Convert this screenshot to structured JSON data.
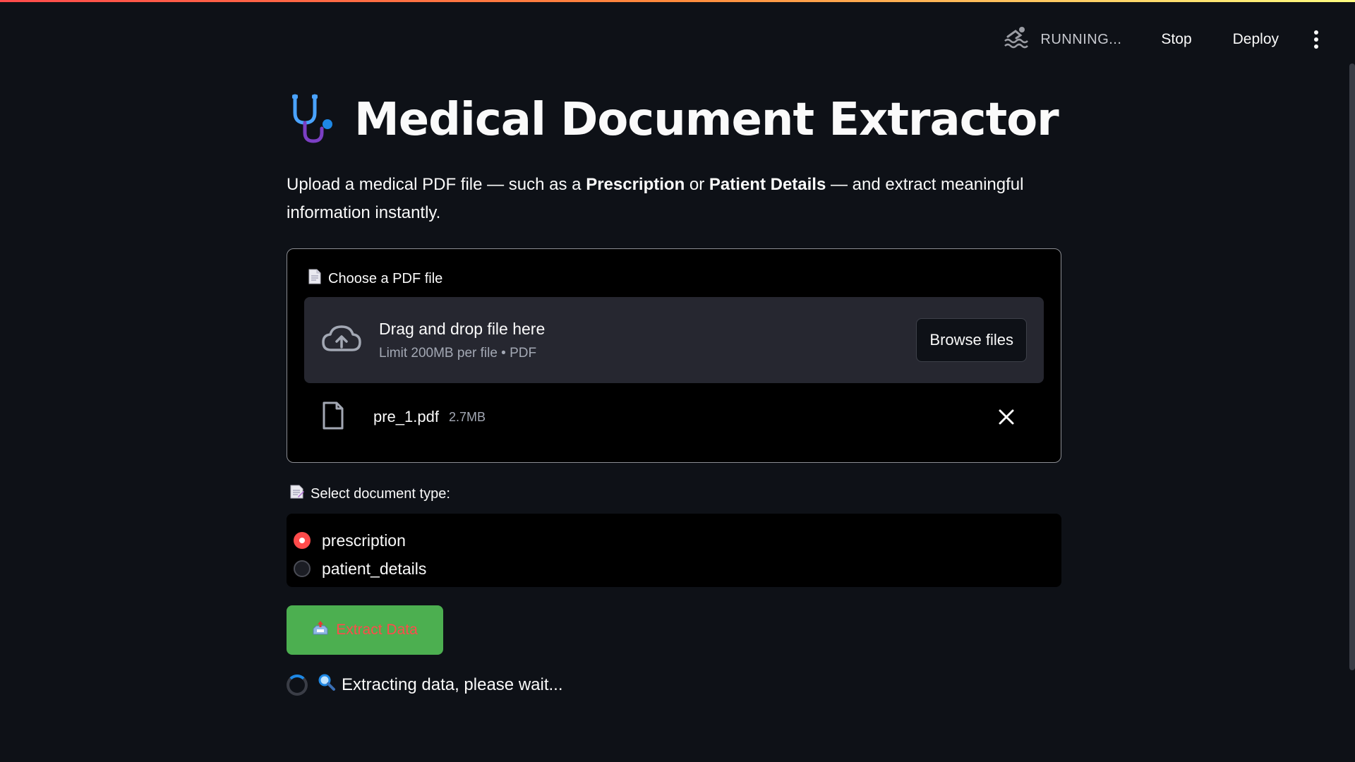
{
  "header": {
    "status_text": "RUNNING...",
    "stop_label": "Stop",
    "deploy_label": "Deploy",
    "status_icon": "swimmer-icon",
    "menu_icon": "kebab-menu-icon"
  },
  "page": {
    "title_icon": "stethoscope-icon",
    "title": "Medical Document Extractor",
    "intro_prefix": "Upload a medical PDF file — such as a ",
    "intro_bold1": "Prescription",
    "intro_mid": " or ",
    "intro_bold2": "Patient Details",
    "intro_suffix": " — and extract meaningful information instantly."
  },
  "uploader": {
    "label": "Choose a PDF file",
    "dropzone_main": "Drag and drop file here",
    "dropzone_sub": "Limit 200MB per file • PDF",
    "browse_label": "Browse files",
    "file": {
      "name": "pre_1.pdf",
      "size": "2.7MB"
    }
  },
  "doc_type": {
    "label": "Select document type:",
    "options": [
      {
        "label": "prescription",
        "selected": true
      },
      {
        "label": "patient_details",
        "selected": false
      }
    ]
  },
  "extract": {
    "label": "Extract Data"
  },
  "spinner": {
    "text": "Extracting data, please wait..."
  },
  "colors": {
    "background": "#0e1117",
    "accent": "#ff4b4b",
    "button_green": "#4caf50",
    "spinner_blue": "#1e88e5"
  }
}
